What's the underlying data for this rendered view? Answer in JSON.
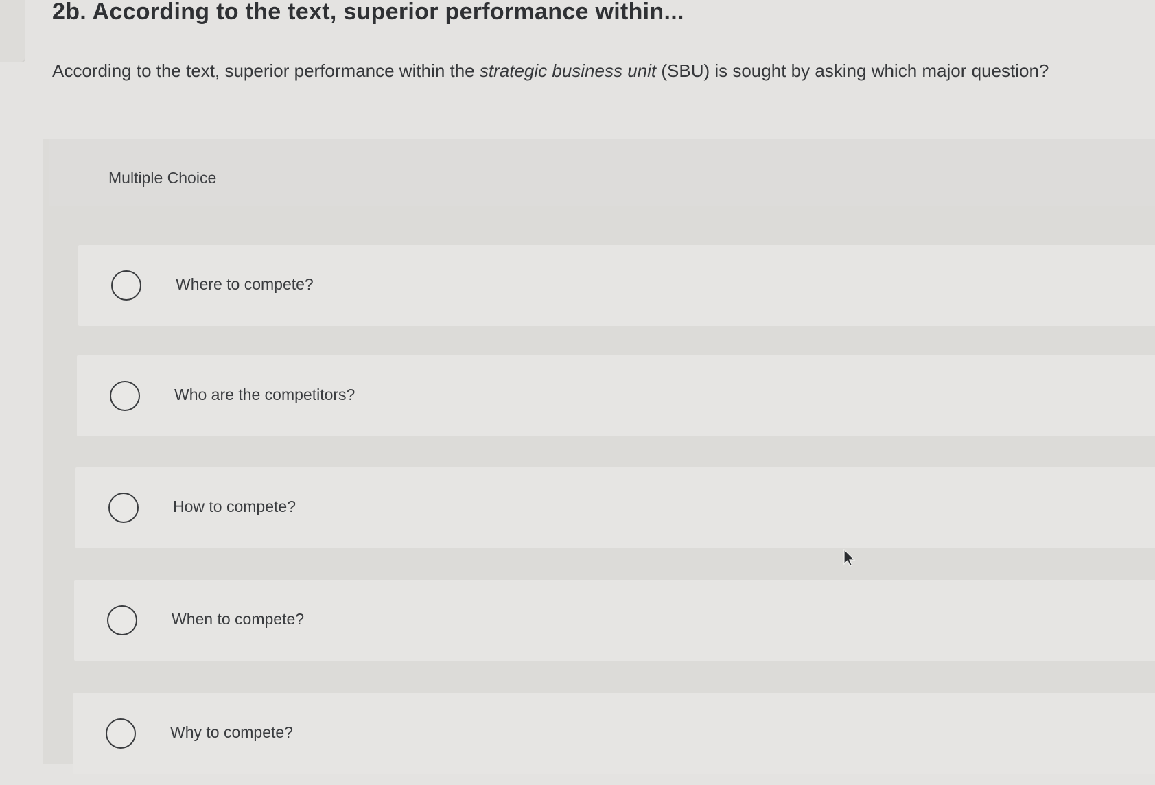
{
  "question": {
    "title": "2b. According to the text, superior performance within...",
    "prompt_before": "According to the text, superior performance within the ",
    "prompt_italic": "strategic business unit",
    "prompt_after": " (SBU) is sought by asking which major question?"
  },
  "answers": {
    "type_label": "Multiple Choice",
    "options": [
      {
        "label": "Where to compete?",
        "selected": false
      },
      {
        "label": "Who are the competitors?",
        "selected": false
      },
      {
        "label": "How to compete?",
        "selected": false
      },
      {
        "label": "When to compete?",
        "selected": false
      },
      {
        "label": "Why to compete?",
        "selected": false
      }
    ]
  },
  "colors": {
    "background": "#e4e3e1",
    "text": "#3b3d40",
    "radio_border": "#3a3c3f"
  },
  "icons": {
    "radio": "radio-button-unselected-icon",
    "cursor": "mouse-pointer-icon"
  }
}
